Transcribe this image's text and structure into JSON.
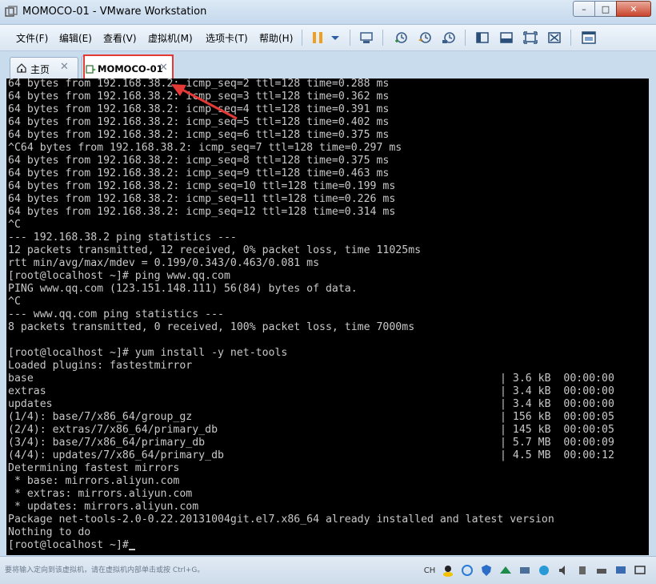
{
  "window": {
    "title": "MOMOCO-01 - VMware Workstation",
    "controls": {
      "minimize": "–",
      "maximize": "□",
      "close": "✕"
    }
  },
  "menu": [
    "文件(F)",
    "编辑(E)",
    "查看(V)",
    "虚拟机(M)",
    "选项卡(T)",
    "帮助(H)"
  ],
  "toolbar": {
    "icons": [
      "pause-icon",
      "dropdown-icon",
      "send-ctrl-alt-del-icon",
      "snapshot-take-icon",
      "snapshot-revert-icon",
      "snapshot-manager-icon",
      "library-icon",
      "console-view-icon",
      "fullscreen-icon",
      "unity-icon",
      "thumbnail-icon"
    ]
  },
  "tabs": [
    {
      "label": "主页",
      "icon": "home-icon"
    },
    {
      "label": "MOMOCO-01",
      "icon": "vm-icon"
    }
  ],
  "terminal": {
    "lines": [
      "64 bytes from 192.168.38.2: icmp_seq=2 ttl=128 time=0.288 ms",
      "64 bytes from 192.168.38.2: icmp_seq=3 ttl=128 time=0.362 ms",
      "64 bytes from 192.168.38.2: icmp_seq=4 ttl=128 time=0.391 ms",
      "64 bytes from 192.168.38.2: icmp_seq=5 ttl=128 time=0.402 ms",
      "64 bytes from 192.168.38.2: icmp_seq=6 ttl=128 time=0.375 ms",
      "^C64 bytes from 192.168.38.2: icmp_seq=7 ttl=128 time=0.297 ms",
      "64 bytes from 192.168.38.2: icmp_seq=8 ttl=128 time=0.375 ms",
      "64 bytes from 192.168.38.2: icmp_seq=9 ttl=128 time=0.463 ms",
      "64 bytes from 192.168.38.2: icmp_seq=10 ttl=128 time=0.199 ms",
      "64 bytes from 192.168.38.2: icmp_seq=11 ttl=128 time=0.226 ms",
      "64 bytes from 192.168.38.2: icmp_seq=12 ttl=128 time=0.314 ms",
      "^C",
      "--- 192.168.38.2 ping statistics ---",
      "12 packets transmitted, 12 received, 0% packet loss, time 11025ms",
      "rtt min/avg/max/mdev = 0.199/0.343/0.463/0.081 ms",
      "[root@localhost ~]# ping www.qq.com",
      "PING www.qq.com (123.151.148.111) 56(84) bytes of data.",
      "^C",
      "--- www.qq.com ping statistics ---",
      "8 packets transmitted, 0 received, 100% packet loss, time 7000ms",
      "",
      "[root@localhost ~]# yum install -y net-tools",
      "Loaded plugins: fastestmirror",
      "base",
      "extras",
      "updates",
      "(1/4): base/7/x86_64/group_gz",
      "(2/4): extras/7/x86_64/primary_db",
      "(3/4): base/7/x86_64/primary_db",
      "(4/4): updates/7/x86_64/primary_db",
      "Determining fastest mirrors",
      " * base: mirrors.aliyun.com",
      " * extras: mirrors.aliyun.com",
      " * updates: mirrors.aliyun.com",
      "Package net-tools-2.0-0.22.20131004git.el7.x86_64 already installed and latest version",
      "Nothing to do",
      "[root@localhost ~]#"
    ],
    "download_stats": [
      "| 3.6 kB  00:00:00",
      "| 3.4 kB  00:00:00",
      "| 3.4 kB  00:00:00",
      "| 156 kB  00:00:05",
      "| 145 kB  00:00:05",
      "| 5.7 MB  00:00:09",
      "| 4.5 MB  00:00:12"
    ]
  },
  "statusbar": {
    "hint": "要将输入定向到该虚拟机，请在虚拟机内部单击或按 Ctrl+G。",
    "tray": [
      "CH",
      "user-icon",
      "sync-icon",
      "shield-icon",
      "network-icon",
      "link-icon",
      "play-icon",
      "sound-icon",
      "usb-icon",
      "printer-icon",
      "message-icon",
      "display-icon"
    ]
  },
  "colors": {
    "accent": "#e53935",
    "terminal_bg": "#000000",
    "terminal_fg": "#c8c8c8"
  }
}
